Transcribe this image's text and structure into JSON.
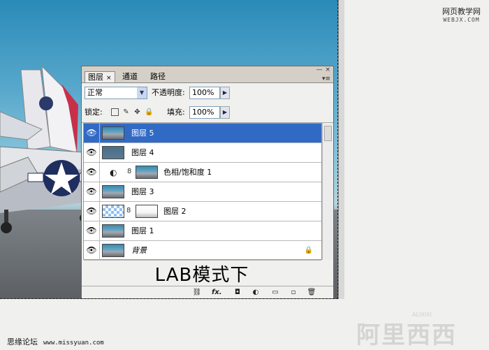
{
  "watermark_top": {
    "line1": "网页教学网",
    "line2": "WEBJX.COM"
  },
  "watermark_bottom_left": {
    "label": "思缘论坛",
    "url": "www.missyuan.com"
  },
  "watermark_bottom_right": {
    "label": "阿里西西",
    "small": "ALIXIXI"
  },
  "panel": {
    "tabs": [
      {
        "label": "图层",
        "close": "×"
      },
      {
        "label": "通道"
      },
      {
        "label": "路径"
      }
    ],
    "window_controls": {
      "minimize": "—",
      "close": "×",
      "menu": "▾≡"
    },
    "blend_mode": "正常",
    "opacity_label": "不透明度:",
    "opacity_value": "100%",
    "lock_label": "锁定:",
    "fill_label": "填充:",
    "fill_value": "100%",
    "layers": [
      {
        "name": "图层 5",
        "selected": true
      },
      {
        "name": "图层 4"
      },
      {
        "name": "色相/饱和度 1"
      },
      {
        "name": "图层 3"
      },
      {
        "name": "图层 2"
      },
      {
        "name": "图层 1"
      },
      {
        "name": "背景"
      }
    ],
    "caption": "LAB模式下"
  },
  "icons": {
    "eye": "👁",
    "link": "⛓",
    "fx": "fx.",
    "mask": "◘",
    "adjustment": "◐",
    "group": "▭",
    "new_layer": "▫",
    "trash": "🗑",
    "chain": "8",
    "lock": "🔒",
    "spin": "▶"
  }
}
